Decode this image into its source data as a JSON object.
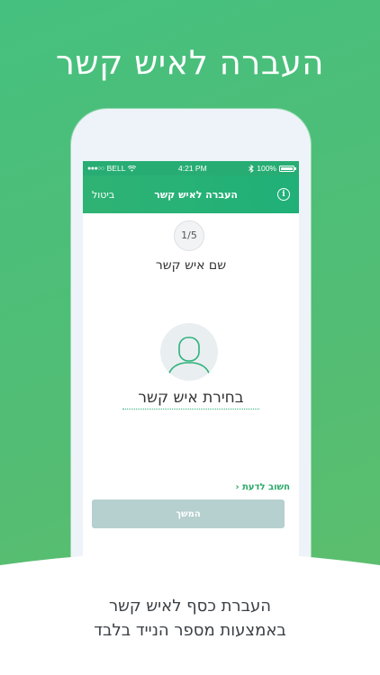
{
  "headline": "העברה לאיש קשר",
  "status_bar": {
    "carrier": "BELL",
    "signal_dots": "●●●○○",
    "time": "4:21 PM",
    "battery": "100%"
  },
  "nav": {
    "cancel": "ביטול",
    "title": "העברה לאיש קשר",
    "info": "i"
  },
  "step": "1/5",
  "field_title": "שם איש קשר",
  "choose_contact": "בחירת איש קשר",
  "important_link": "חשוב לדעת ‹",
  "continue_label": "המשך",
  "caption": {
    "line1": "העברת כסף לאיש קשר",
    "line2": "באמצעות מספר הנייד בלבד"
  },
  "colors": {
    "brand_green": "#27ad73",
    "button_disabled": "#b6cfcf",
    "link_green": "#2aa968"
  }
}
